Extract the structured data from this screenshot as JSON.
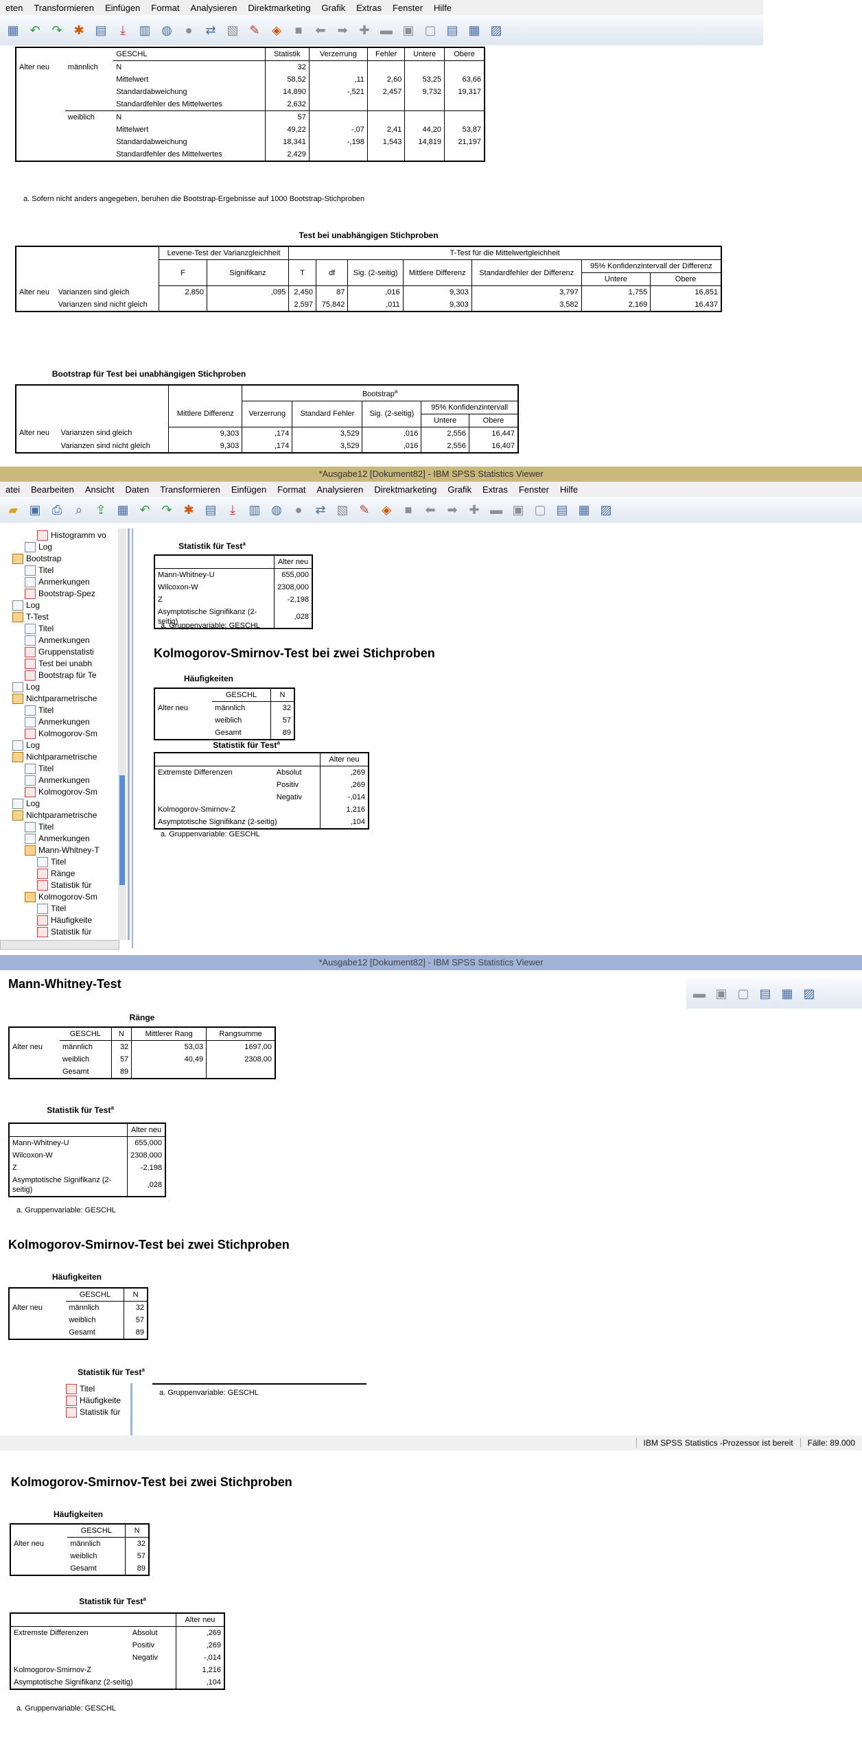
{
  "window1": {
    "menu": [
      "eten",
      "Transformieren",
      "Einfügen",
      "Format",
      "Analysieren",
      "Direktmarketing",
      "Grafik",
      "Extras",
      "Fenster",
      "Hilfe"
    ],
    "bootstrap_group_table": {
      "headers": [
        "GESCHL",
        "Statistik",
        "Verzerrung",
        "Fehler",
        "Untere",
        "Obere"
      ],
      "row_var": "Alter neu",
      "groups": [
        {
          "name": "männlich",
          "rows": [
            [
              "N",
              "32",
              "",
              "",
              "",
              ""
            ],
            [
              "Mittelwert",
              "58,52",
              ",11",
              "2,60",
              "53,25",
              "63,66"
            ],
            [
              "Standardabweichung",
              "14,890",
              "-,521",
              "2,457",
              "9,732",
              "19,317"
            ],
            [
              "Standardfehler des Mittelwertes",
              "2,632",
              "",
              "",
              "",
              ""
            ]
          ]
        },
        {
          "name": "weiblich",
          "rows": [
            [
              "N",
              "57",
              "",
              "",
              "",
              ""
            ],
            [
              "Mittelwert",
              "49,22",
              "-,07",
              "2,41",
              "44,20",
              "53,87"
            ],
            [
              "Standardabweichung",
              "18,341",
              "-,198",
              "1,543",
              "14,819",
              "21,197"
            ],
            [
              "Standardfehler des Mittelwertes",
              "2,429",
              "",
              "",
              "",
              ""
            ]
          ]
        }
      ],
      "footnote": "a. Sofern nicht anders angegeben, beruhen die Bootstrap-Ergebnisse auf 1000 Bootstrap-Stichproben"
    },
    "ttest": {
      "title": "Test bei unabhängigen Stichproben",
      "levene_header": "Levene-Test der Varianzgleichheit",
      "t_header": "T-Test für die Mittelwertgleichheit",
      "ci_header": "95% Konfidenzintervall der Differenz",
      "cols": [
        "F",
        "Signifikanz",
        "T",
        "df",
        "Sig. (2-seitig)",
        "Mittlere Differenz",
        "Standardfehler der Differenz",
        "Untere",
        "Obere"
      ],
      "var": "Alter neu",
      "rows": [
        {
          "label": "Varianzen sind gleich",
          "vals": [
            "2,850",
            ",095",
            "2,450",
            "87",
            ",016",
            "9,303",
            "3,797",
            "1,755",
            "16,851"
          ]
        },
        {
          "label": "Varianzen sind nicht gleich",
          "vals": [
            "",
            "",
            "2,597",
            "75,842",
            ",011",
            "9,303",
            "3,582",
            "2,169",
            "16,437"
          ]
        }
      ]
    },
    "bootstrap_ttest": {
      "title": "Bootstrap für Test bei unabhängigen Stichproben",
      "bootstrap_header": "Bootstrap",
      "ci_header": "95% Konfidenzintervall",
      "cols": [
        "Mittlere Differenz",
        "Verzerrung",
        "Standard Fehler",
        "Sig. (2-seitig)",
        "Untere",
        "Obere"
      ],
      "var": "Alter neu",
      "rows": [
        {
          "label": "Varianzen sind gleich",
          "vals": [
            "9,303",
            ",174",
            "3,529",
            ",016",
            "2,556",
            "16,447"
          ]
        },
        {
          "label": "Varianzen sind nicht gleich",
          "vals": [
            "9,303",
            ",174",
            "3,529",
            ",016",
            "2,556",
            "16,407"
          ]
        }
      ]
    }
  },
  "window2": {
    "title": "*Ausgabe12 [Dokument82] - IBM SPSS Statistics Viewer",
    "menu": [
      "atei",
      "Bearbeiten",
      "Ansicht",
      "Daten",
      "Transformieren",
      "Einfügen",
      "Format",
      "Analysieren",
      "Direktmarketing",
      "Grafik",
      "Extras",
      "Fenster",
      "Hilfe"
    ],
    "tree": [
      {
        "indent": 3,
        "icon": "red",
        "label": "Histogramm vo"
      },
      {
        "indent": 2,
        "icon": "doc",
        "label": "Log"
      },
      {
        "indent": 1,
        "icon": "book",
        "label": "Bootstrap"
      },
      {
        "indent": 2,
        "icon": "doc",
        "label": "Titel"
      },
      {
        "indent": 2,
        "icon": "doc",
        "label": "Anmerkungen"
      },
      {
        "indent": 2,
        "icon": "red",
        "label": "Bootstrap-Spez"
      },
      {
        "indent": 1,
        "icon": "doc",
        "label": "Log"
      },
      {
        "indent": 1,
        "icon": "book",
        "label": "T-Test"
      },
      {
        "indent": 2,
        "icon": "doc",
        "label": "Titel"
      },
      {
        "indent": 2,
        "icon": "doc",
        "label": "Anmerkungen"
      },
      {
        "indent": 2,
        "icon": "red",
        "label": "Gruppenstatisti"
      },
      {
        "indent": 2,
        "icon": "red",
        "label": "Test bei unabh"
      },
      {
        "indent": 2,
        "icon": "red",
        "label": "Bootstrap für Te"
      },
      {
        "indent": 1,
        "icon": "doc",
        "label": "Log"
      },
      {
        "indent": 1,
        "icon": "book",
        "label": "Nichtparametrische"
      },
      {
        "indent": 2,
        "icon": "doc",
        "label": "Titel"
      },
      {
        "indent": 2,
        "icon": "doc",
        "label": "Anmerkungen"
      },
      {
        "indent": 2,
        "icon": "red",
        "label": "Kolmogorov-Sm"
      },
      {
        "indent": 1,
        "icon": "doc",
        "label": "Log"
      },
      {
        "indent": 1,
        "icon": "book",
        "label": "Nichtparametrische"
      },
      {
        "indent": 2,
        "icon": "doc",
        "label": "Titel"
      },
      {
        "indent": 2,
        "icon": "doc",
        "label": "Anmerkungen"
      },
      {
        "indent": 2,
        "icon": "red",
        "label": "Kolmogorov-Sm"
      },
      {
        "indent": 1,
        "icon": "doc",
        "label": "Log"
      },
      {
        "indent": 1,
        "icon": "book",
        "label": "Nichtparametrische"
      },
      {
        "indent": 2,
        "icon": "doc",
        "label": "Titel"
      },
      {
        "indent": 2,
        "icon": "doc",
        "label": "Anmerkungen"
      },
      {
        "indent": 2,
        "icon": "book",
        "label": "Mann-Whitney-T"
      },
      {
        "indent": 3,
        "icon": "doc",
        "label": "Titel"
      },
      {
        "indent": 3,
        "icon": "red",
        "label": "Ränge"
      },
      {
        "indent": 3,
        "icon": "red",
        "label": "Statistik für"
      },
      {
        "indent": 2,
        "icon": "book",
        "label": "Kolmogorov-Sm"
      },
      {
        "indent": 3,
        "icon": "doc",
        "label": "Titel"
      },
      {
        "indent": 3,
        "icon": "red",
        "label": "Häufigkeite"
      },
      {
        "indent": 3,
        "icon": "red",
        "label": "Statistik für"
      }
    ],
    "mw_stat": {
      "title": "Statistik für Test",
      "col": "Alter neu",
      "rows": [
        [
          "Mann-Whitney-U",
          "655,000"
        ],
        [
          "Wilcoxon-W",
          "2308,000"
        ],
        [
          "Z",
          "-2,198"
        ],
        [
          "Asymptotische Signifikanz (2-seitig)",
          ",028"
        ]
      ],
      "footnote": "a. Gruppenvariable: GESCHL"
    },
    "ks_heading": "Kolmogorov-Smirnov-Test bei zwei Stichproben",
    "freq": {
      "title": "Häufigkeiten",
      "headers": [
        "GESCHL",
        "N"
      ],
      "var": "Alter neu",
      "rows": [
        [
          "männlich",
          "32"
        ],
        [
          "weiblich",
          "57"
        ],
        [
          "Gesamt",
          "89"
        ]
      ]
    },
    "ks_stat": {
      "title": "Statistik für Test",
      "col": "Alter neu",
      "group_label": "Extremste Differenzen",
      "rows": [
        [
          "Absolut",
          ",269"
        ],
        [
          "Positiv",
          ",269"
        ],
        [
          "Negativ",
          "-,014"
        ]
      ],
      "other_rows": [
        [
          "Kolmogorov-Smirnov-Z",
          "1,216"
        ],
        [
          "Asymptotische Signifikanz (2-seitig)",
          ",104"
        ]
      ],
      "footnote": "a. Gruppenvariable: GESCHL"
    }
  },
  "window3": {
    "title": "*Ausgabe12 [Dokument82] - IBM SPSS Statistics Viewer",
    "mw_heading": "Mann-Whitney-Test",
    "ranks": {
      "title": "Ränge",
      "headers": [
        "GESCHL",
        "N",
        "Mittlerer Rang",
        "Rangsumme"
      ],
      "var": "Alter neu",
      "rows": [
        [
          "männlich",
          "32",
          "53,03",
          "1697,00"
        ],
        [
          "weiblich",
          "57",
          "40,49",
          "2308,00"
        ],
        [
          "Gesamt",
          "89",
          "",
          ""
        ]
      ]
    },
    "status_left": "IBM SPSS Statistics -Prozessor ist bereit",
    "status_right": "Fälle: 89.000",
    "partial_tree": [
      "Titel",
      "Häufigkeite",
      "Statistik für"
    ]
  }
}
